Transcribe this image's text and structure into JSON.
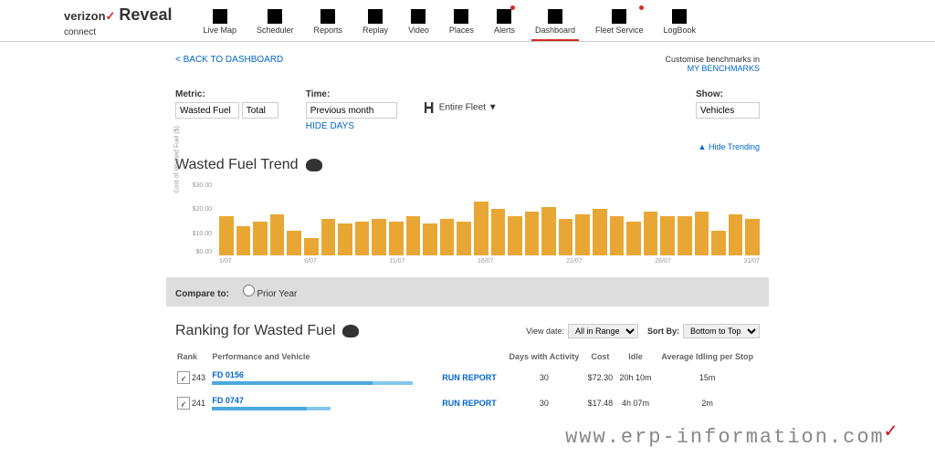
{
  "brand": {
    "name1": "verizon",
    "name2": "Reveal",
    "connect": "connect"
  },
  "nav": [
    {
      "label": "Live Map"
    },
    {
      "label": "Scheduler"
    },
    {
      "label": "Reports"
    },
    {
      "label": "Replay"
    },
    {
      "label": "Video"
    },
    {
      "label": "Places"
    },
    {
      "label": "Alerts"
    },
    {
      "label": "Dashboard"
    },
    {
      "label": "Fleet Service"
    },
    {
      "label": "LogBook"
    }
  ],
  "back_link": "< BACK TO DASHBOARD",
  "bench": {
    "line1": "Customise benchmarks in",
    "line2": "MY BENCHMARKS"
  },
  "filters": {
    "metric": {
      "label": "Metric:",
      "value1": "Wasted Fuel",
      "value2": "Total"
    },
    "time": {
      "label": "Time:",
      "value": "Previous month",
      "hide_days": "HIDE DAYS"
    },
    "scope": {
      "value": "Entire Fleet"
    },
    "show": {
      "label": "Show:",
      "value": "Vehicles"
    }
  },
  "hide_trending": "▲ Hide Trending",
  "trend_title": "Wasted Fuel Trend",
  "compare": {
    "label": "Compare to:",
    "option": "Prior Year"
  },
  "ranking": {
    "title": "Ranking for Wasted Fuel",
    "view_date_label": "View date:",
    "view_date": "All in Range",
    "sort_label": "Sort By:",
    "sort": "Bottom to Top",
    "cols": {
      "rank": "Rank",
      "perf": "Performance and Vehicle",
      "days": "Days with Activity",
      "cost": "Cost",
      "idle": "Idle",
      "avg": "Average Idling per Stop"
    },
    "run_report": "RUN REPORT",
    "rows": [
      {
        "rank": "243",
        "vehicle": "FD 0156",
        "days": "30",
        "cost": "$72.30",
        "idle": "20h 10m",
        "avg": "15m"
      },
      {
        "rank": "241",
        "vehicle": "FD 0747",
        "days": "30",
        "cost": "$17.48",
        "idle": "4h 07m",
        "avg": "2m"
      }
    ]
  },
  "watermark": "www.erp-information.com",
  "chart_data": {
    "type": "bar",
    "title": "Wasted Fuel Trend",
    "ylabel": "Cost of Wasted Fuel ($)",
    "ylim": [
      0,
      30
    ],
    "yticks": [
      "$30.00",
      "$20.00",
      "$10.00",
      "$0.00"
    ],
    "xticks": [
      "1/07",
      "6/07",
      "11/07",
      "16/07",
      "21/07",
      "26/07",
      "31/07"
    ],
    "values": [
      16,
      12,
      14,
      17,
      10,
      7,
      15,
      13,
      14,
      15,
      14,
      16,
      13,
      15,
      14,
      22,
      19,
      16,
      18,
      20,
      15,
      17,
      19,
      16,
      14,
      18,
      16,
      16,
      18,
      10,
      17,
      15
    ]
  }
}
